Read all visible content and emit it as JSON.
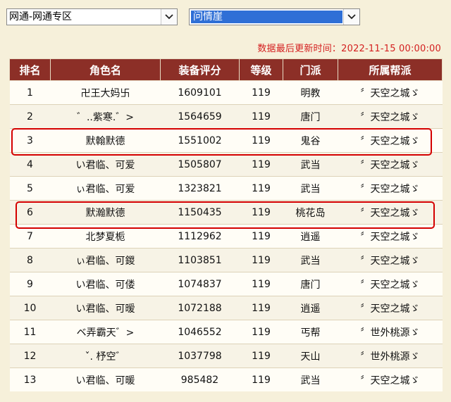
{
  "server_select": {
    "value": "网通-网通专区"
  },
  "realm_select": {
    "value": "问情崖"
  },
  "update_text": "数据最后更新时间：2022-11-15 00:00:00",
  "table": {
    "headers": [
      "排名",
      "角色名",
      "装备评分",
      "等级",
      "门派",
      "所属帮派"
    ],
    "rows": [
      [
        "1",
        "卍王大妈卐",
        "1609101",
        "119",
        "明教",
        "〞天空之城ゞ"
      ],
      [
        "2",
        "゛..紫寒.゛>",
        "1564659",
        "119",
        "唐门",
        "〞天空之城ゞ"
      ],
      [
        "3",
        "默翰默德",
        "1551002",
        "119",
        "鬼谷",
        "〞天空之城ゞ"
      ],
      [
        "4",
        "い君临、可爱",
        "1505807",
        "119",
        "武当",
        "〞天空之城ゞ"
      ],
      [
        "5",
        "ぃ君临、可爱",
        "1323821",
        "119",
        "武当",
        "〞天空之城ゞ"
      ],
      [
        "6",
        "默瀚默德",
        "1150435",
        "119",
        "桃花岛",
        "〞天空之城ゞ"
      ],
      [
        "7",
        "北梦夏栀",
        "1112962",
        "119",
        "逍遥",
        "〞天空之城ゞ"
      ],
      [
        "8",
        "ぃ君临、可鍐",
        "1103851",
        "119",
        "武当",
        "〞天空之城ゞ"
      ],
      [
        "9",
        "い君临、可偻",
        "1074837",
        "119",
        "唐门",
        "〞天空之城ゞ"
      ],
      [
        "10",
        "い君临、可暧",
        "1072188",
        "119",
        "逍遥",
        "〞天空之城ゞ"
      ],
      [
        "11",
        "ベ弄霸天゛>",
        "1046552",
        "119",
        "丐帮",
        "〞世外桃源ゞ"
      ],
      [
        "12",
        "ˇ. 杼空゛",
        "1037798",
        "119",
        "天山",
        "〞世外桃源ゞ"
      ],
      [
        "13",
        "い君临、可暖",
        "985482",
        "119",
        "武当",
        "〞天空之城ゞ"
      ]
    ]
  },
  "highlight_ranks": [
    "3",
    "6"
  ],
  "colors": {
    "header_bg": "#8c2f27",
    "highlight": "#d40000",
    "update_text": "#d42020"
  },
  "icons": {
    "dropdown": "chevron-down-icon"
  }
}
